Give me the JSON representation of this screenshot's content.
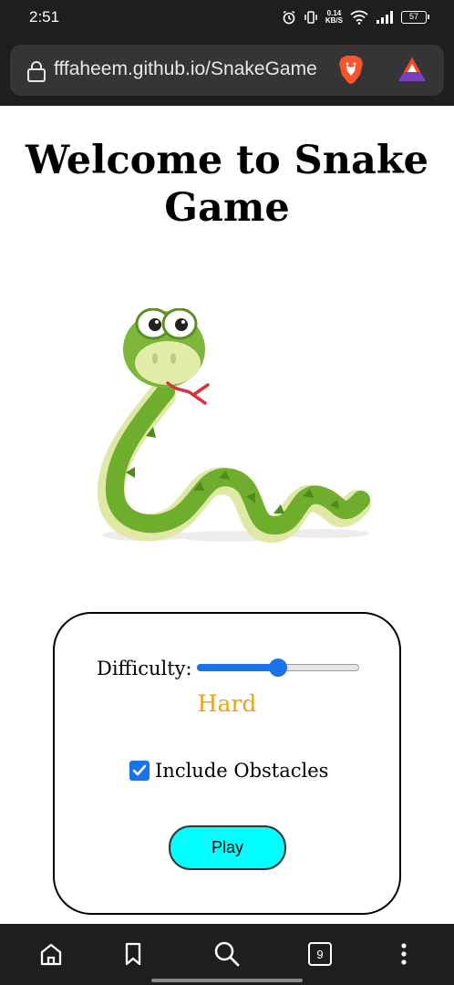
{
  "status_bar": {
    "time": "2:51",
    "network_speed": "0.14",
    "network_unit": "KB/S",
    "battery": "57"
  },
  "browser": {
    "url": "fffaheem.github.io/SnakeGame",
    "icons": [
      "lock-icon",
      "brave-lion-icon",
      "brave-rewards-icon"
    ]
  },
  "page": {
    "title": "Welcome to Snake Game",
    "difficulty_label": "Difficulty:",
    "difficulty_value": "Hard",
    "difficulty_level": 0.5,
    "obstacles_label": "Include Obstacles",
    "obstacles_checked": true,
    "play_label": "Play",
    "colors": {
      "difficulty_text": "#e8a317",
      "play_button": "#00ffff",
      "accent": "#1a73e8"
    }
  },
  "bottom_nav": {
    "tab_count": "9",
    "icons": [
      "home-icon",
      "bookmark-icon",
      "search-icon",
      "tabs-icon",
      "more-icon"
    ]
  }
}
